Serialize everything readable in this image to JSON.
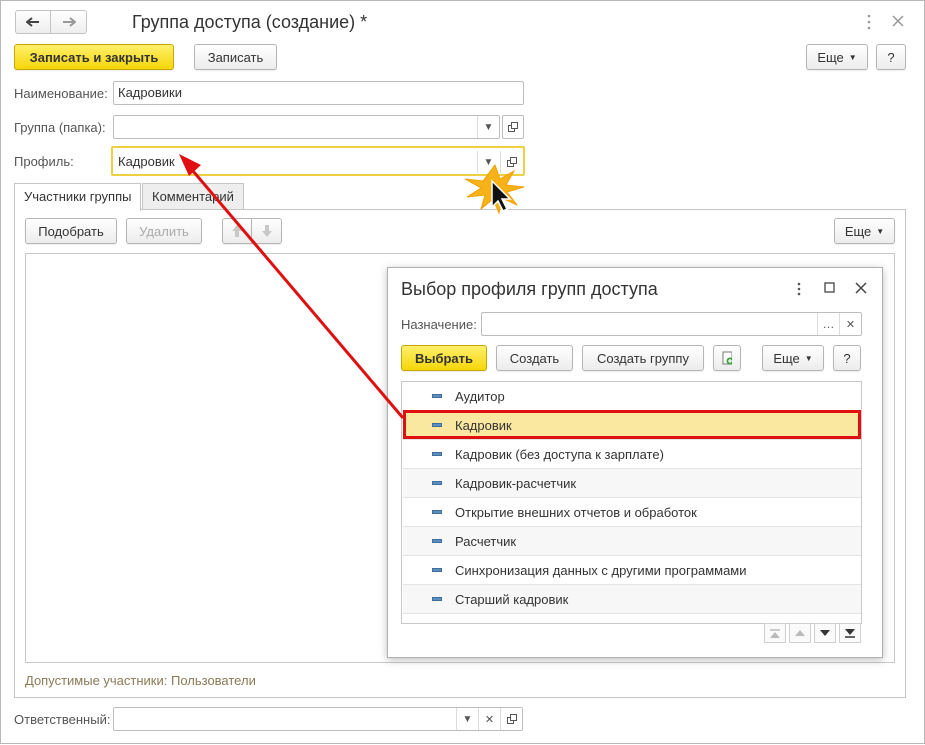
{
  "window": {
    "title": "Группа доступа (создание) *"
  },
  "toolbar": {
    "save_close_label": "Записать и закрыть",
    "save_label": "Записать",
    "more_label": "Еще",
    "help_label": "?"
  },
  "form": {
    "name_label": "Наименование:",
    "name_value": "Кадровики",
    "group_label": "Группа (папка):",
    "group_value": "",
    "profile_label": "Профиль:",
    "profile_value": "Кадровик",
    "responsible_label": "Ответственный:",
    "responsible_value": ""
  },
  "tabs": [
    "Участники группы",
    "Комментарий"
  ],
  "members": {
    "pick_label": "Подобрать",
    "delete_label": "Удалить",
    "more_label": "Еще",
    "allowed_text": "Допустимые участники: Пользователи"
  },
  "dialog": {
    "title": "Выбор профиля групп доступа",
    "purpose_label": "Назначение:",
    "purpose_value": "",
    "select_label": "Выбрать",
    "create_label": "Создать",
    "create_group_label": "Создать группу",
    "more_label": "Еще",
    "help_label": "?",
    "items": [
      "Аудитор",
      "Кадровик",
      "Кадровик (без доступа к зарплате)",
      "Кадровик-расчетчик",
      "Открытие внешних отчетов и обработок",
      "Расчетчик",
      "Синхронизация данных с другими программами",
      "Старший кадровик"
    ],
    "selected_index": 1
  },
  "colors": {
    "accent_yellow": "#f5d60a",
    "highlight_red": "#e01010",
    "selection": "#fbe8a0"
  }
}
